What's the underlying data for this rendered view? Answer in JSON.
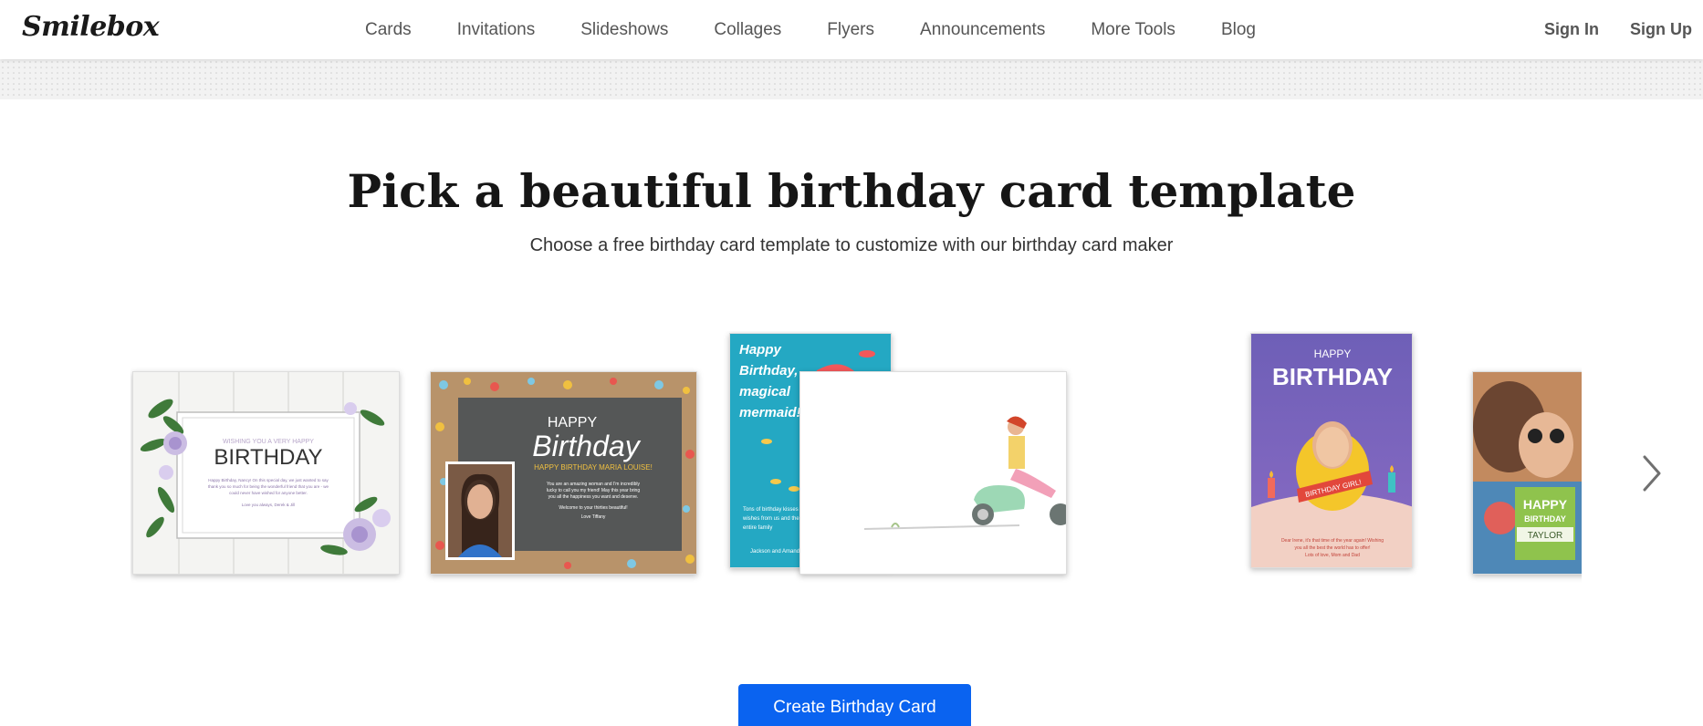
{
  "header": {
    "logo": "Smilebox",
    "nav": [
      "Cards",
      "Invitations",
      "Slideshows",
      "Collages",
      "Flyers",
      "Announcements",
      "More Tools",
      "Blog"
    ],
    "sign_in": "Sign In",
    "sign_up": "Sign Up"
  },
  "main": {
    "title": "Pick a beautiful birthday card template",
    "subtitle": "Choose a free birthday card template to customize with our birthday card maker",
    "cta": "Create Birthday Card"
  },
  "cards": {
    "floral": {
      "top": "WISHING YOU A VERY HAPPY",
      "main": "BIRTHDAY",
      "line1": "Happy Birthday, Nancy! On this special day, we just wanted to say",
      "line2": "thank you so much for being the wonderful friend that you are - we",
      "line3": "could never have wished for anyone better.",
      "sign": "Love you always, Derek & Jill"
    },
    "chalk": {
      "happy": "HAPPY",
      "birthday": "Birthday",
      "name": "HAPPY BIRTHDAY MARIA LOUISE!",
      "line1": "You are an amazing woman and I'm incredibly",
      "line2": "lucky to call you my friend! May this year bring",
      "line3": "you all the happiness you want and deserve.",
      "line4": "Welcome to your thirties beautiful!",
      "sign": "Love Tiffany"
    },
    "mermaid": {
      "l1": "Happy",
      "l2": "Birthday,",
      "l3": "magical",
      "l4": "mermaid!",
      "msg1": "Tons of birthday kisses and",
      "msg2": "wishes from us and the",
      "msg3": "entire family",
      "sign": "Jackson and Amanda"
    },
    "bird": {
      "happy": "HAPPY",
      "birthday": "BIRTHDAY",
      "banner": "BIRTHDAY GIRL!",
      "msg1": "Dear Irene, it's that time of the year again! Wishing",
      "msg2": "you all the best the world has to offer!",
      "msg3": "Lots of love, Mom and Dad"
    },
    "taylor": {
      "happy": "HAPPY",
      "birthday": "BIRTHDAY",
      "name": "TAYLOR"
    }
  },
  "colors": {
    "cta": "#0a63f0"
  },
  "icons": {
    "next": "chevron-right-icon"
  }
}
